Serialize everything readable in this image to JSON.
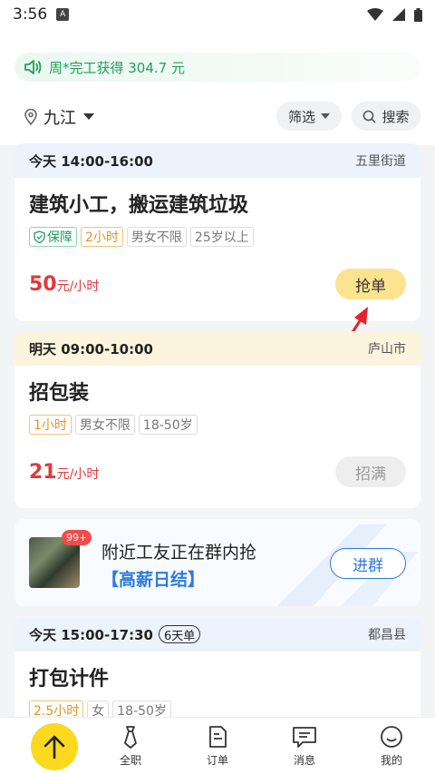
{
  "status": {
    "time": "3:56",
    "app_badge": "A"
  },
  "notice": {
    "text": "周*完工获得 304.7 元"
  },
  "location": {
    "city": "九江"
  },
  "toolbar": {
    "filter_label": "筛选",
    "search_label": "搜索"
  },
  "jobs": [
    {
      "time": "今天 14:00-16:00",
      "area": "五里街道",
      "title": "建筑小工，搬运建筑垃圾",
      "tags": [
        "保障",
        "2小时",
        "男女不限",
        "25岁以上"
      ],
      "price": "50",
      "price_unit": "元/小时",
      "action": "抢单"
    },
    {
      "time": "明天 09:00-10:00",
      "area": "庐山市",
      "title": "招包装",
      "tags": [
        "1小时",
        "男女不限",
        "18-50岁"
      ],
      "price": "21",
      "price_unit": "元/小时",
      "action": "招满"
    },
    {
      "time": "今天 15:00-17:30",
      "days": "6天单",
      "area": "都昌县",
      "title": "打包计件",
      "tags": [
        "2.5小时",
        "女",
        "18-50岁"
      ]
    }
  ],
  "group": {
    "badge": "99+",
    "line1": "附近工友正在群内抢",
    "line2": "【高薪日结】",
    "join_label": "进群"
  },
  "tabs": [
    {
      "label": "全职",
      "icon": "tie-icon"
    },
    {
      "label": "订单",
      "icon": "document-icon"
    },
    {
      "label": "消息",
      "icon": "message-icon"
    },
    {
      "label": "我的",
      "icon": "smile-icon"
    }
  ],
  "colors": {
    "accent_yellow": "#fcd81f",
    "price_red": "#e0393e",
    "brand_blue": "#2d7be0",
    "notice_green": "#21a05c"
  }
}
